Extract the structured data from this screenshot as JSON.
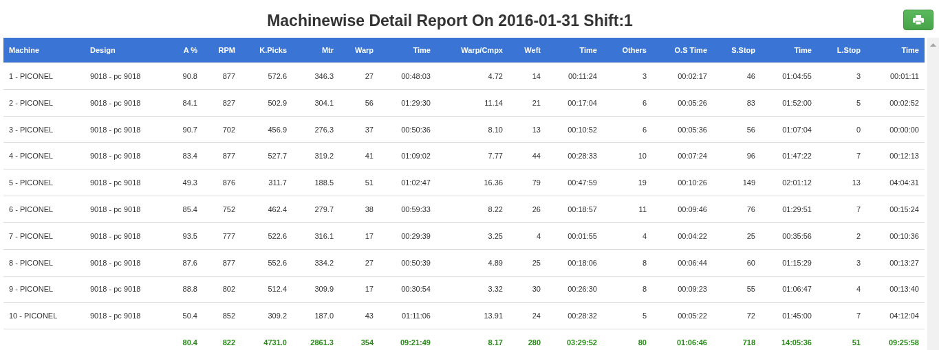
{
  "title": "Machinewise Detail Report On 2016-01-31 Shift:1",
  "table": {
    "columns": [
      "Machine",
      "Design",
      "A %",
      "RPM",
      "K.Picks",
      "Mtr",
      "Warp",
      "Time",
      "Warp/Cmpx",
      "Weft",
      "Time",
      "Others",
      "O.S Time",
      "S.Stop",
      "Time",
      "L.Stop",
      "Time"
    ],
    "rows": [
      [
        "1 - PICONEL",
        "9018 - pc 9018",
        "90.8",
        "877",
        "572.6",
        "346.3",
        "27",
        "00:48:03",
        "4.72",
        "14",
        "00:11:24",
        "3",
        "00:02:17",
        "46",
        "01:04:55",
        "3",
        "00:01:11"
      ],
      [
        "2 - PICONEL",
        "9018 - pc 9018",
        "84.1",
        "827",
        "502.9",
        "304.1",
        "56",
        "01:29:30",
        "11.14",
        "21",
        "00:17:04",
        "6",
        "00:05:26",
        "83",
        "01:52:00",
        "5",
        "00:02:52"
      ],
      [
        "3 - PICONEL",
        "9018 - pc 9018",
        "90.7",
        "702",
        "456.9",
        "276.3",
        "37",
        "00:50:36",
        "8.10",
        "13",
        "00:10:52",
        "6",
        "00:05:36",
        "56",
        "01:07:04",
        "0",
        "00:00:00"
      ],
      [
        "4 - PICONEL",
        "9018 - pc 9018",
        "83.4",
        "877",
        "527.7",
        "319.2",
        "41",
        "01:09:02",
        "7.77",
        "44",
        "00:28:33",
        "10",
        "00:07:24",
        "96",
        "01:47:22",
        "7",
        "00:12:13"
      ],
      [
        "5 - PICONEL",
        "9018 - pc 9018",
        "49.3",
        "876",
        "311.7",
        "188.5",
        "51",
        "01:02:47",
        "16.36",
        "79",
        "00:47:59",
        "19",
        "00:10:26",
        "149",
        "02:01:12",
        "13",
        "04:04:31"
      ],
      [
        "6 - PICONEL",
        "9018 - pc 9018",
        "85.4",
        "752",
        "462.4",
        "279.7",
        "38",
        "00:59:33",
        "8.22",
        "26",
        "00:18:57",
        "11",
        "00:09:46",
        "76",
        "01:29:51",
        "7",
        "00:15:24"
      ],
      [
        "7 - PICONEL",
        "9018 - pc 9018",
        "93.5",
        "777",
        "522.6",
        "316.1",
        "17",
        "00:29:39",
        "3.25",
        "4",
        "00:01:55",
        "4",
        "00:04:22",
        "25",
        "00:35:56",
        "2",
        "00:10:36"
      ],
      [
        "8 - PICONEL",
        "9018 - pc 9018",
        "87.6",
        "877",
        "552.6",
        "334.2",
        "27",
        "00:50:39",
        "4.89",
        "25",
        "00:18:06",
        "8",
        "00:06:44",
        "60",
        "01:15:29",
        "3",
        "00:13:27"
      ],
      [
        "9 - PICONEL",
        "9018 - pc 9018",
        "88.8",
        "802",
        "512.4",
        "309.9",
        "17",
        "00:30:54",
        "3.32",
        "30",
        "00:26:30",
        "8",
        "00:09:23",
        "55",
        "01:06:47",
        "4",
        "00:13:40"
      ],
      [
        "10 - PICONEL",
        "9018 - pc 9018",
        "50.4",
        "852",
        "309.2",
        "187.0",
        "43",
        "01:11:06",
        "13.91",
        "24",
        "00:28:32",
        "5",
        "00:05:22",
        "72",
        "01:45:00",
        "7",
        "04:12:04"
      ]
    ],
    "totals": [
      "80.4",
      "822",
      "4731.0",
      "2861.3",
      "354",
      "09:21:49",
      "8.17",
      "280",
      "03:29:52",
      "80",
      "01:06:46",
      "718",
      "14:05:36",
      "51",
      "09:25:58"
    ]
  }
}
